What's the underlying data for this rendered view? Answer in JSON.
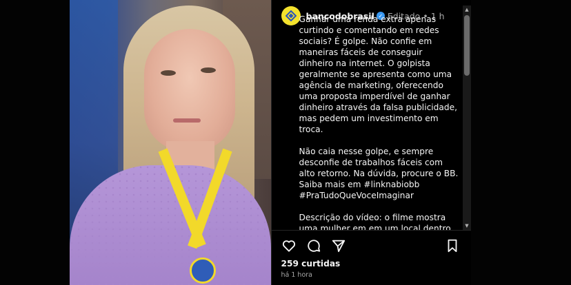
{
  "post": {
    "username": "bancodobrasil",
    "edited_label": "Editado",
    "age": "1 h",
    "caption": [
      "Ganhar uma renda extra apenas curtindo e comentando em redes sociais? É golpe. Não confie em maneiras fáceis de conseguir dinheiro na internet. O golpista geralmente se apresenta como uma agência de marketing, oferecendo uma proposta imperdível de ganhar dinheiro através da falsa publicidade, mas pedem um investimento em troca.",
      "Não caia nesse golpe, e sempre desconfie de trabalhos fáceis com alto retorno. Na dúvida, procure o BB. Saiba mais em #linknabiobb\n#PraTudoQueVoceImaginar",
      "Descrição do vídeo: o filme mostra uma mulher em em um local dentro do Banco do Brasil, mostrando..."
    ],
    "likes": "259 curtidas",
    "time_ago": "há 1 hora"
  },
  "icons": {
    "verified": "verified-badge-icon",
    "like": "heart-icon",
    "comment": "comment-icon",
    "share": "share-icon",
    "save": "bookmark-icon",
    "scroll_up": "scroll-up-arrow",
    "scroll_down": "scroll-down-arrow"
  },
  "colors": {
    "background": "#000000",
    "avatar": "#f4e22d",
    "verified": "#3897f0",
    "text": "#f5f5f5",
    "muted": "#a8a8a8"
  }
}
